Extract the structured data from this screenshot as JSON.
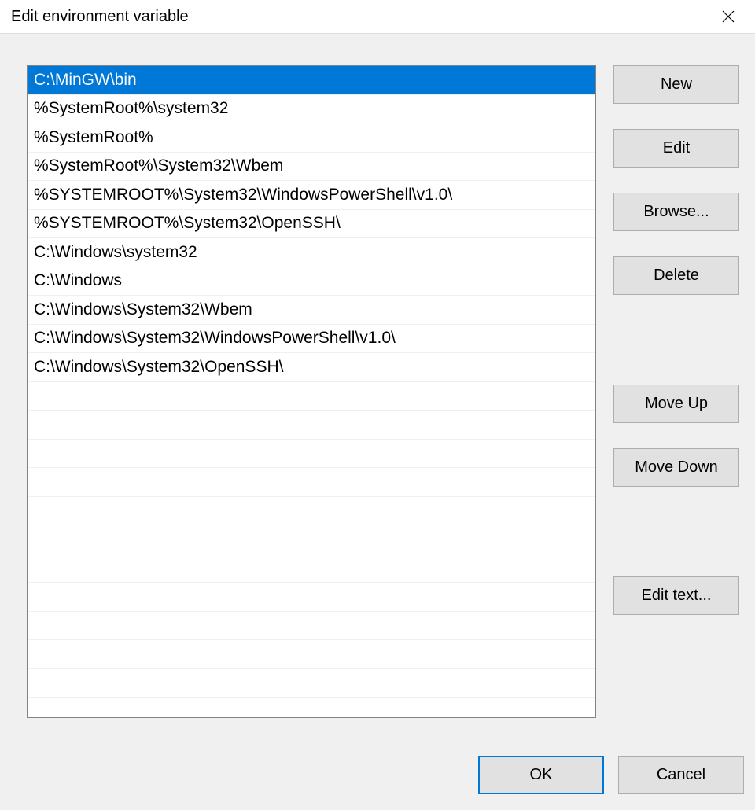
{
  "title": "Edit environment variable",
  "list": {
    "selectedIndex": 0,
    "items": [
      "C:\\MinGW\\bin",
      "%SystemRoot%\\system32",
      "%SystemRoot%",
      "%SystemRoot%\\System32\\Wbem",
      "%SYSTEMROOT%\\System32\\WindowsPowerShell\\v1.0\\",
      "%SYSTEMROOT%\\System32\\OpenSSH\\",
      "C:\\Windows\\system32",
      "C:\\Windows",
      "C:\\Windows\\System32\\Wbem",
      "C:\\Windows\\System32\\WindowsPowerShell\\v1.0\\",
      "C:\\Windows\\System32\\OpenSSH\\"
    ],
    "totalVisibleRows": 22
  },
  "buttons": {
    "new": "New",
    "edit": "Edit",
    "browse": "Browse...",
    "delete": "Delete",
    "moveUp": "Move Up",
    "moveDown": "Move Down",
    "editText": "Edit text...",
    "ok": "OK",
    "cancel": "Cancel"
  }
}
